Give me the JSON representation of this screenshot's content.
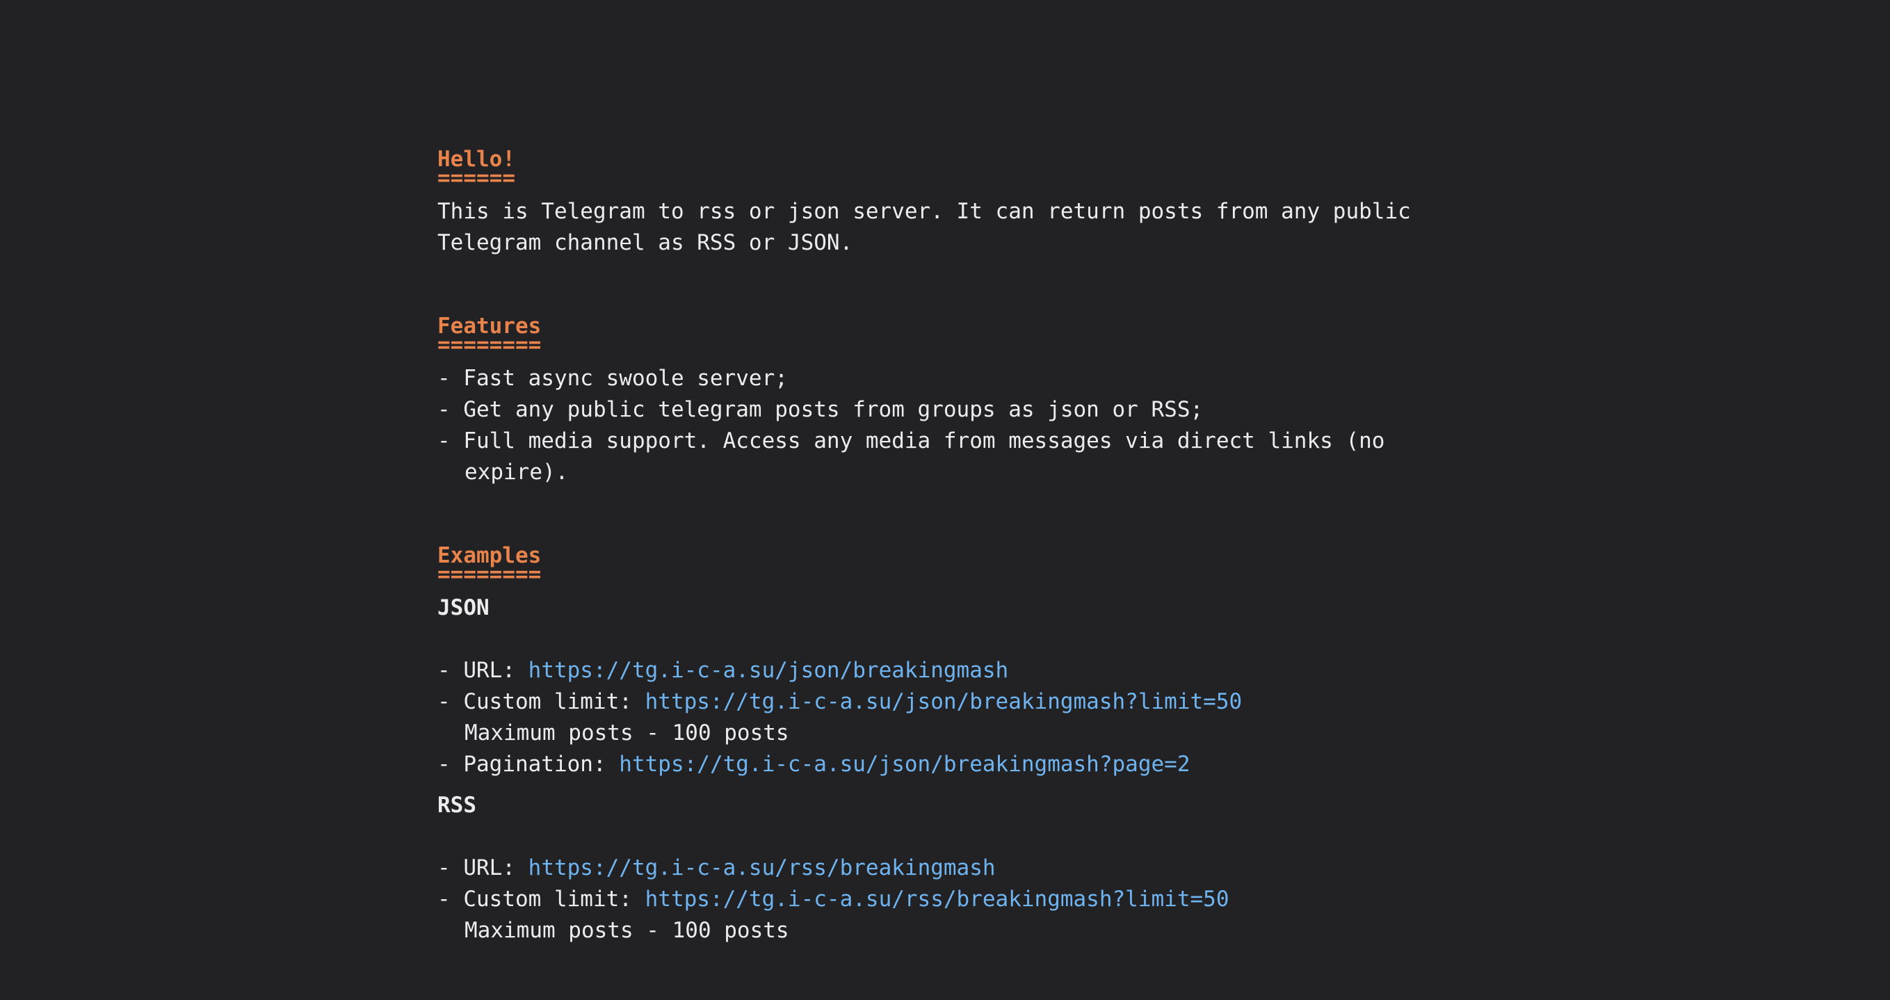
{
  "hello": {
    "title": "Hello!",
    "underline": "======",
    "lines": [
      "This is Telegram to rss or json server. It can return posts from any public",
      "Telegram channel as RSS or JSON."
    ]
  },
  "features": {
    "title": "Features",
    "underline": "========",
    "items": [
      "- Fast async swoole server;",
      "- Get any public telegram posts from groups as json or RSS;",
      "- Full media support. Access any media from messages via direct links (no"
    ],
    "continuation": "expire)."
  },
  "examples": {
    "title": "Examples",
    "underline": "========",
    "json": {
      "label": "JSON",
      "url_prefix": "- URL: ",
      "url": "https://tg.i-c-a.su/json/breakingmash",
      "limit_prefix": "- Custom limit: ",
      "limit_url": "https://tg.i-c-a.su/json/breakingmash?limit=50",
      "max_note": "Maximum posts - 100 posts",
      "page_prefix": "- Pagination: ",
      "page_url": "https://tg.i-c-a.su/json/breakingmash?page=2"
    },
    "rss": {
      "label": "RSS",
      "url_prefix": "- URL: ",
      "url": "https://tg.i-c-a.su/rss/breakingmash",
      "limit_prefix": "- Custom limit: ",
      "limit_url": "https://tg.i-c-a.su/rss/breakingmash?limit=50",
      "max_note": "Maximum posts - 100 posts"
    }
  },
  "colors": {
    "background": "#222225",
    "heading": "#e8834c",
    "link": "#6fb3ef",
    "text": "#ececec"
  }
}
